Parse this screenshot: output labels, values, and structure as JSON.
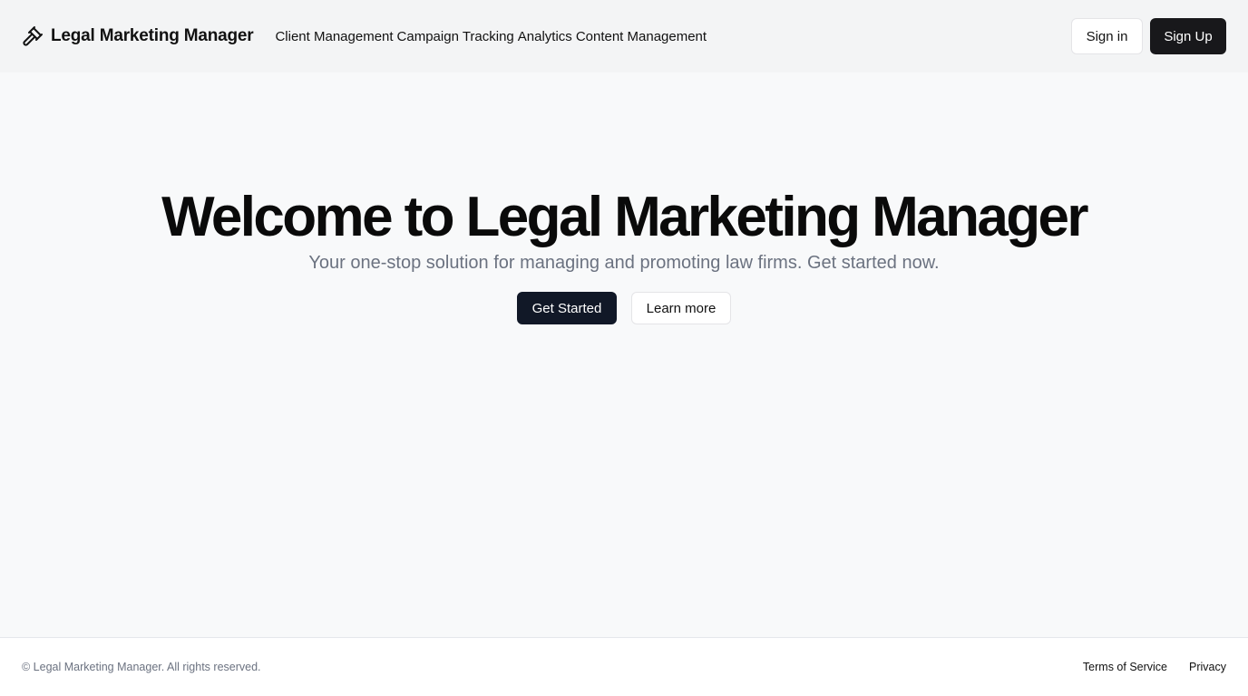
{
  "header": {
    "brand_name": "Legal Marketing Manager",
    "brand_icon": "gavel-icon",
    "nav": [
      {
        "label": "Client Management"
      },
      {
        "label": "Campaign Tracking"
      },
      {
        "label": "Analytics"
      },
      {
        "label": "Content Management"
      }
    ],
    "signin_label": "Sign in",
    "signup_label": "Sign Up"
  },
  "hero": {
    "title": "Welcome to Legal Marketing Manager",
    "subtitle": "Your one-stop solution for managing and promoting law firms. Get started now.",
    "primary_label": "Get Started",
    "secondary_label": "Learn more"
  },
  "footer": {
    "copyright": "© Legal Marketing Manager. All rights reserved.",
    "links": [
      {
        "label": "Terms of Service"
      },
      {
        "label": "Privacy"
      }
    ]
  },
  "colors": {
    "header_bg": "#f3f4f5",
    "page_bg": "#f8f9fa",
    "primary_dark": "#18181b",
    "muted_text": "#6b7280"
  }
}
